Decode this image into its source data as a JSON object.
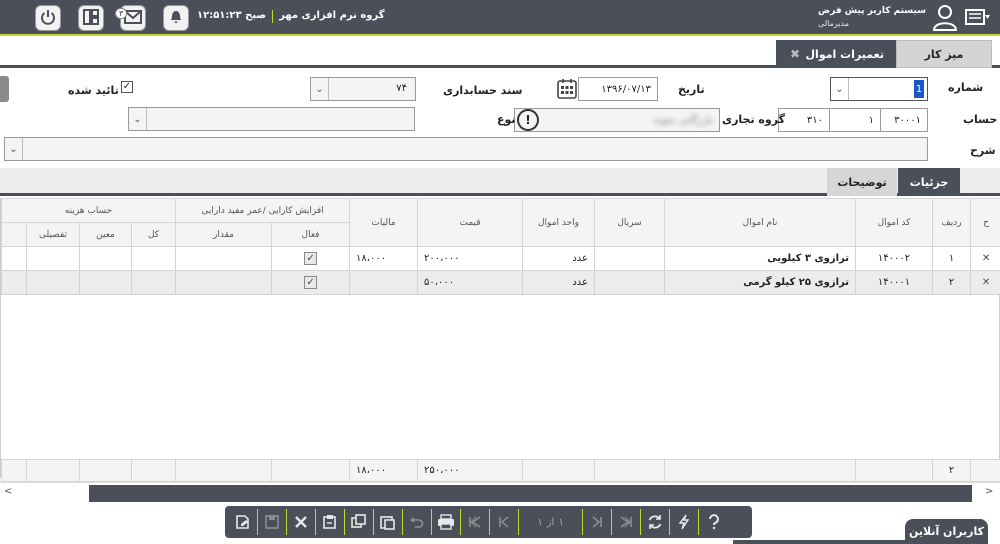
{
  "header": {
    "system_title": "سیستم کاربر پیش فرض",
    "user_role": "مدیرمالی",
    "company": "گروه نرم افزاری مهر",
    "clock": "۱۲:۵۱:۲۳ صبح",
    "mail_badge": "۳"
  },
  "tabs": {
    "desk": "میز کار",
    "active": "تعمیرات اموال"
  },
  "form": {
    "number_label": "شماره",
    "number_value": "1",
    "date_label": "تاریخ",
    "date_value": "۱۳۹۶/۰۷/۱۳",
    "doc_label": "سند حسابداری",
    "doc_value": "۷۴",
    "approved_label": "تائید شده",
    "approved_checked": true,
    "account_label": "حساب",
    "account_code": "۳۰۰۰۱",
    "account_sub": "۱",
    "account_code2": "۳۱۰",
    "business_group_label": "گروه تجاری",
    "business_group_value": "بازرگانی نمونه",
    "type_label": "نوع",
    "type_value": "",
    "desc_label": "شرح",
    "desc_value": ""
  },
  "detail_tabs": {
    "details": "جزئیات",
    "descriptions": "توضیحات"
  },
  "grid": {
    "columns": {
      "del": "ح",
      "row": "ردیف",
      "code": "کد اموال",
      "name": "نام اموال",
      "serial": "سریال",
      "unit": "واحد اموال",
      "price": "قیمت",
      "tax": "مالیات",
      "group_efficiency": "افزایش کارایی /عمر مفید دارایی",
      "active": "فعال",
      "amount": "مقدار",
      "group_cost": "حساب هزینه",
      "total": "کل",
      "specific": "معین",
      "detailed": "تفصیلی"
    },
    "rows": [
      {
        "row": "۱",
        "code": "۱۴۰۰۰۲",
        "name": "ترازوی ۳ کیلویی",
        "serial": "",
        "unit": "عدد",
        "price": "۲۰۰،۰۰۰",
        "tax": "۱۸،۰۰۰",
        "active": "✓"
      },
      {
        "row": "۲",
        "code": "۱۴۰۰۰۱",
        "name": "ترازوی ۲۵ کیلو گرمی",
        "serial": "",
        "unit": "عدد",
        "price": "۵۰،۰۰۰",
        "tax": "",
        "active": "✓"
      }
    ],
    "totals": {
      "count": "۲",
      "price": "۲۵۰،۰۰۰",
      "tax": "۱۸،۰۰۰"
    }
  },
  "toolbar": {
    "page_current": "۱",
    "page_of": "از",
    "page_total": "۱"
  },
  "online_users": "کاربران آنلاین"
}
